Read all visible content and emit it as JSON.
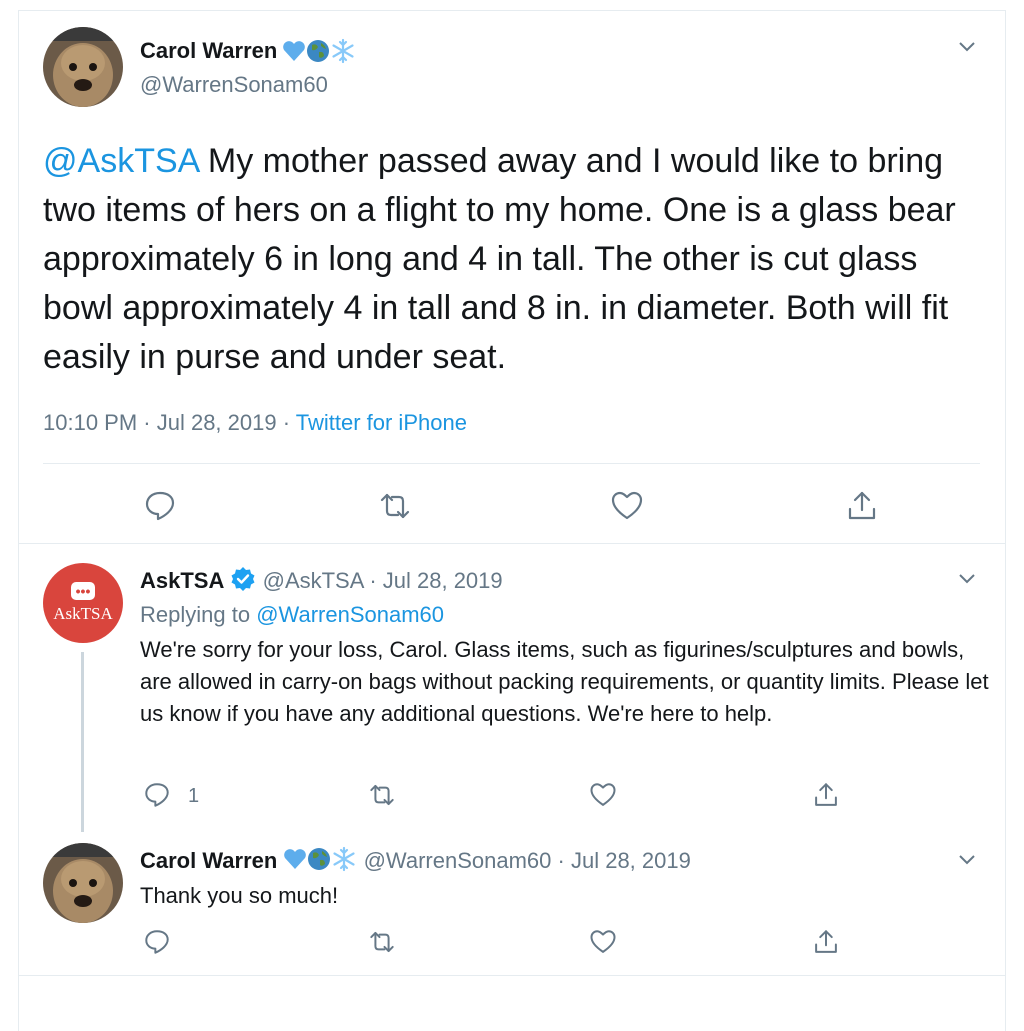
{
  "main_tweet": {
    "author_name": "Carol Warren",
    "author_handle": "@WarrenSonam60",
    "mention": "@AskTSA",
    "body": " My mother passed away and I would like to bring two items of hers on a flight to my home. One is a glass bear approximately 6 in long and 4 in tall. The other is cut glass bowl approximately 4 in tall and 8 in. in diameter. Both will fit easily in purse and under seat.",
    "timestamp": "10:10 PM · Jul 28, 2019 ·",
    "source": "Twitter for iPhone"
  },
  "reply": {
    "author_name": "AskTSA",
    "author_handle": "@AskTSA",
    "date": "· Jul 28, 2019",
    "replying_prefix": "Replying to",
    "replying_to": "@WarrenSonam60",
    "body": "We're sorry for your loss, Carol. Glass items, such as figurines/sculptures and bowls, are allowed in carry-on bags without packing requirements, or quantity limits. Please let us know if you have any additional questions. We're here to help.",
    "reply_count": "1",
    "avatar_text": "AskTSA"
  },
  "second_reply": {
    "author_name": "Carol Warren",
    "author_handle": "@WarrenSonam60",
    "date": "· Jul 28, 2019",
    "body": "Thank you so much!"
  },
  "icons": {
    "emoji_1": "blue-heart-icon",
    "emoji_2": "globe-icon",
    "emoji_3": "snowflake-icon",
    "verified": "verified-badge-icon"
  },
  "colors": {
    "link": "#1b95e0",
    "muted": "#657786",
    "tsa_brand": "#d9453d"
  }
}
